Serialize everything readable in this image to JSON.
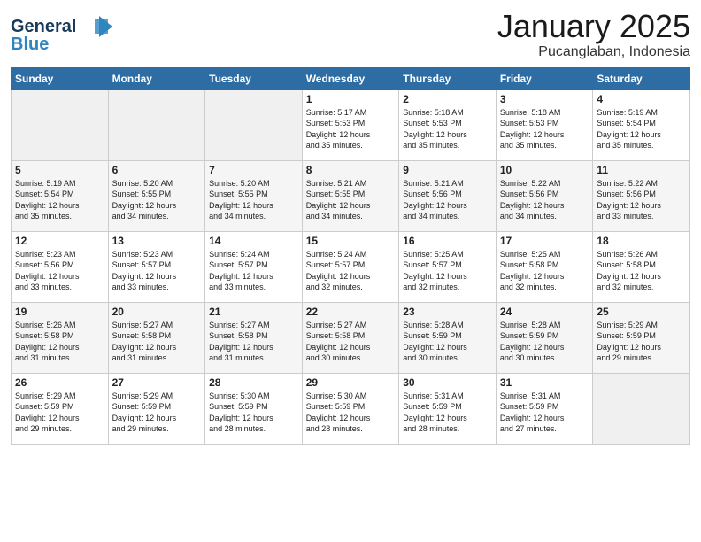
{
  "header": {
    "logo_line1": "General",
    "logo_line2": "Blue",
    "month": "January 2025",
    "location": "Pucanglaban, Indonesia"
  },
  "days_of_week": [
    "Sunday",
    "Monday",
    "Tuesday",
    "Wednesday",
    "Thursday",
    "Friday",
    "Saturday"
  ],
  "weeks": [
    [
      {
        "num": "",
        "info": ""
      },
      {
        "num": "",
        "info": ""
      },
      {
        "num": "",
        "info": ""
      },
      {
        "num": "1",
        "info": "Sunrise: 5:17 AM\nSunset: 5:53 PM\nDaylight: 12 hours\nand 35 minutes."
      },
      {
        "num": "2",
        "info": "Sunrise: 5:18 AM\nSunset: 5:53 PM\nDaylight: 12 hours\nand 35 minutes."
      },
      {
        "num": "3",
        "info": "Sunrise: 5:18 AM\nSunset: 5:53 PM\nDaylight: 12 hours\nand 35 minutes."
      },
      {
        "num": "4",
        "info": "Sunrise: 5:19 AM\nSunset: 5:54 PM\nDaylight: 12 hours\nand 35 minutes."
      }
    ],
    [
      {
        "num": "5",
        "info": "Sunrise: 5:19 AM\nSunset: 5:54 PM\nDaylight: 12 hours\nand 35 minutes."
      },
      {
        "num": "6",
        "info": "Sunrise: 5:20 AM\nSunset: 5:55 PM\nDaylight: 12 hours\nand 34 minutes."
      },
      {
        "num": "7",
        "info": "Sunrise: 5:20 AM\nSunset: 5:55 PM\nDaylight: 12 hours\nand 34 minutes."
      },
      {
        "num": "8",
        "info": "Sunrise: 5:21 AM\nSunset: 5:55 PM\nDaylight: 12 hours\nand 34 minutes."
      },
      {
        "num": "9",
        "info": "Sunrise: 5:21 AM\nSunset: 5:56 PM\nDaylight: 12 hours\nand 34 minutes."
      },
      {
        "num": "10",
        "info": "Sunrise: 5:22 AM\nSunset: 5:56 PM\nDaylight: 12 hours\nand 34 minutes."
      },
      {
        "num": "11",
        "info": "Sunrise: 5:22 AM\nSunset: 5:56 PM\nDaylight: 12 hours\nand 33 minutes."
      }
    ],
    [
      {
        "num": "12",
        "info": "Sunrise: 5:23 AM\nSunset: 5:56 PM\nDaylight: 12 hours\nand 33 minutes."
      },
      {
        "num": "13",
        "info": "Sunrise: 5:23 AM\nSunset: 5:57 PM\nDaylight: 12 hours\nand 33 minutes."
      },
      {
        "num": "14",
        "info": "Sunrise: 5:24 AM\nSunset: 5:57 PM\nDaylight: 12 hours\nand 33 minutes."
      },
      {
        "num": "15",
        "info": "Sunrise: 5:24 AM\nSunset: 5:57 PM\nDaylight: 12 hours\nand 32 minutes."
      },
      {
        "num": "16",
        "info": "Sunrise: 5:25 AM\nSunset: 5:57 PM\nDaylight: 12 hours\nand 32 minutes."
      },
      {
        "num": "17",
        "info": "Sunrise: 5:25 AM\nSunset: 5:58 PM\nDaylight: 12 hours\nand 32 minutes."
      },
      {
        "num": "18",
        "info": "Sunrise: 5:26 AM\nSunset: 5:58 PM\nDaylight: 12 hours\nand 32 minutes."
      }
    ],
    [
      {
        "num": "19",
        "info": "Sunrise: 5:26 AM\nSunset: 5:58 PM\nDaylight: 12 hours\nand 31 minutes."
      },
      {
        "num": "20",
        "info": "Sunrise: 5:27 AM\nSunset: 5:58 PM\nDaylight: 12 hours\nand 31 minutes."
      },
      {
        "num": "21",
        "info": "Sunrise: 5:27 AM\nSunset: 5:58 PM\nDaylight: 12 hours\nand 31 minutes."
      },
      {
        "num": "22",
        "info": "Sunrise: 5:27 AM\nSunset: 5:58 PM\nDaylight: 12 hours\nand 30 minutes."
      },
      {
        "num": "23",
        "info": "Sunrise: 5:28 AM\nSunset: 5:59 PM\nDaylight: 12 hours\nand 30 minutes."
      },
      {
        "num": "24",
        "info": "Sunrise: 5:28 AM\nSunset: 5:59 PM\nDaylight: 12 hours\nand 30 minutes."
      },
      {
        "num": "25",
        "info": "Sunrise: 5:29 AM\nSunset: 5:59 PM\nDaylight: 12 hours\nand 29 minutes."
      }
    ],
    [
      {
        "num": "26",
        "info": "Sunrise: 5:29 AM\nSunset: 5:59 PM\nDaylight: 12 hours\nand 29 minutes."
      },
      {
        "num": "27",
        "info": "Sunrise: 5:29 AM\nSunset: 5:59 PM\nDaylight: 12 hours\nand 29 minutes."
      },
      {
        "num": "28",
        "info": "Sunrise: 5:30 AM\nSunset: 5:59 PM\nDaylight: 12 hours\nand 28 minutes."
      },
      {
        "num": "29",
        "info": "Sunrise: 5:30 AM\nSunset: 5:59 PM\nDaylight: 12 hours\nand 28 minutes."
      },
      {
        "num": "30",
        "info": "Sunrise: 5:31 AM\nSunset: 5:59 PM\nDaylight: 12 hours\nand 28 minutes."
      },
      {
        "num": "31",
        "info": "Sunrise: 5:31 AM\nSunset: 5:59 PM\nDaylight: 12 hours\nand 27 minutes."
      },
      {
        "num": "",
        "info": ""
      }
    ]
  ]
}
